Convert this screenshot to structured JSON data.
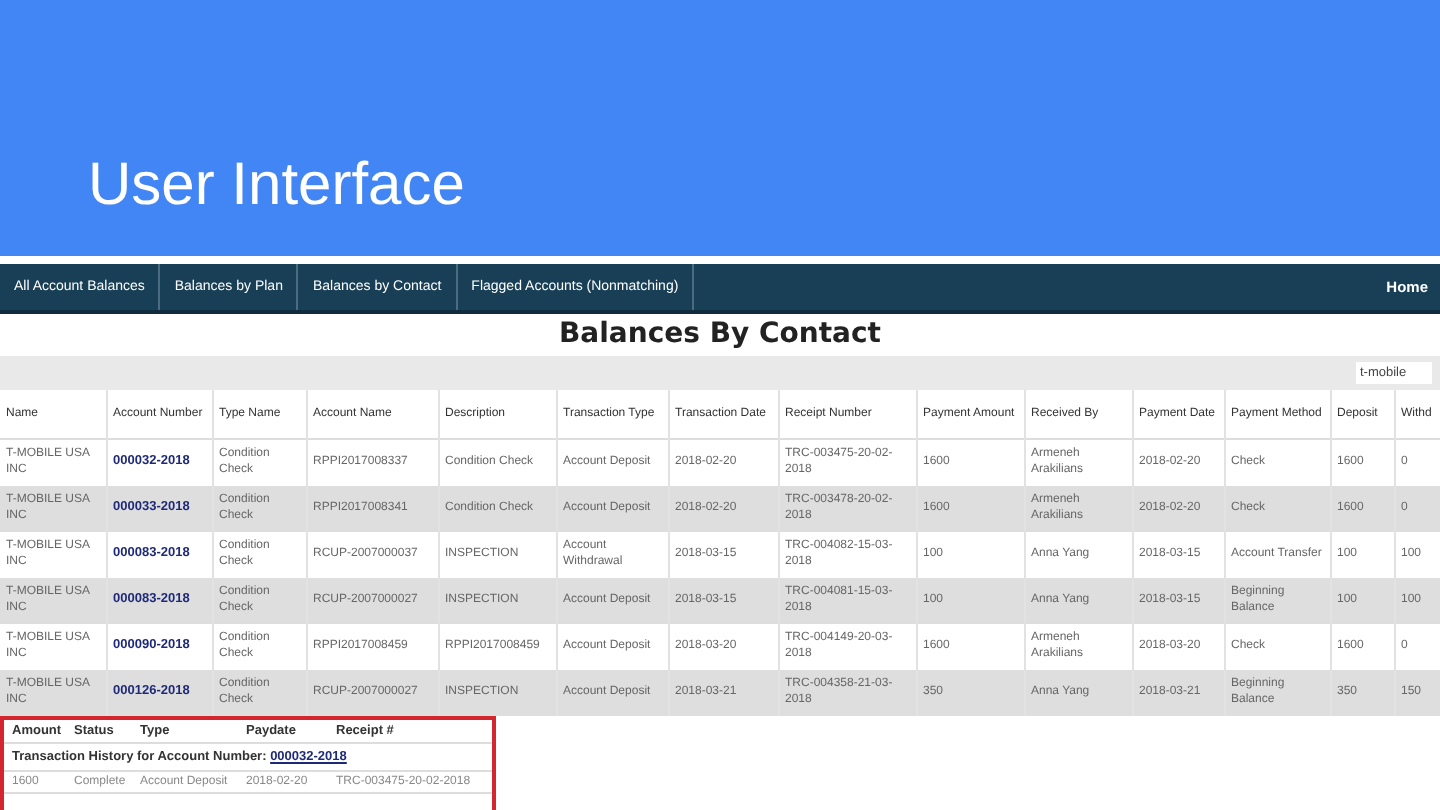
{
  "slide_title": "User Interface",
  "nav": {
    "tabs": [
      "All Account Balances",
      "Balances by Plan",
      "Balances by Contact",
      "Flagged Accounts (Nonmatching)"
    ],
    "home": "Home"
  },
  "heading": "Balances By Contact",
  "filter": {
    "value": "t-mobile"
  },
  "table": {
    "columns": [
      "Name",
      "Account Number",
      "Type Name",
      "Account Name",
      "Description",
      "Transaction Type",
      "Transaction Date",
      "Receipt Number",
      "Payment Amount",
      "Received By",
      "Payment Date",
      "Payment Method",
      "Deposit",
      "Withd"
    ],
    "rows": [
      [
        "T-MOBILE USA INC",
        "000032-2018",
        "Condition Check",
        "RPPI2017008337",
        "Condition Check",
        "Account Deposit",
        "2018-02-20",
        "TRC-003475-20-02-2018",
        "1600",
        "Armeneh Arakilians",
        "2018-02-20",
        "Check",
        "1600",
        "0"
      ],
      [
        "T-MOBILE USA INC",
        "000033-2018",
        "Condition Check",
        "RPPI2017008341",
        "Condition Check",
        "Account Deposit",
        "2018-02-20",
        "TRC-003478-20-02-2018",
        "1600",
        "Armeneh Arakilians",
        "2018-02-20",
        "Check",
        "1600",
        "0"
      ],
      [
        "T-MOBILE USA INC",
        "000083-2018",
        "Condition Check",
        "RCUP-2007000037",
        "INSPECTION",
        "Account Withdrawal",
        "2018-03-15",
        "TRC-004082-15-03-2018",
        "100",
        "Anna Yang",
        "2018-03-15",
        "Account Transfer",
        "100",
        "100"
      ],
      [
        "T-MOBILE USA INC",
        "000083-2018",
        "Condition Check",
        "RCUP-2007000027",
        "INSPECTION",
        "Account Deposit",
        "2018-03-15",
        "TRC-004081-15-03-2018",
        "100",
        "Anna Yang",
        "2018-03-15",
        "Beginning Balance",
        "100",
        "100"
      ],
      [
        "T-MOBILE USA INC",
        "000090-2018",
        "Condition Check",
        "RPPI2017008459",
        "RPPI2017008459",
        "Account Deposit",
        "2018-03-20",
        "TRC-004149-20-03-2018",
        "1600",
        "Armeneh Arakilians",
        "2018-03-20",
        "Check",
        "1600",
        "0"
      ],
      [
        "T-MOBILE USA INC",
        "000126-2018",
        "Condition Check",
        "RCUP-2007000027",
        "INSPECTION",
        "Account Deposit",
        "2018-03-21",
        "TRC-004358-21-03-2018",
        "350",
        "Anna Yang",
        "2018-03-21",
        "Beginning Balance",
        "350",
        "150"
      ]
    ]
  },
  "history": {
    "columns": [
      "Amount",
      "Status",
      "Type",
      "Paydate",
      "Receipt #"
    ],
    "caption": "Transaction History for Account Number:",
    "account": "000032-2018",
    "rows": [
      [
        "1600",
        "Complete",
        "Account Deposit",
        "2018-02-20",
        "TRC-003475-20-02-2018"
      ]
    ]
  }
}
